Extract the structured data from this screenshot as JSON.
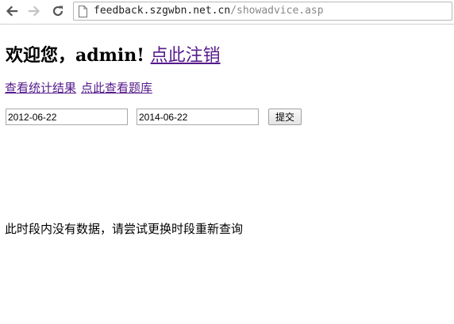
{
  "browser": {
    "url_host": "feedback.szgwbn.net.cn",
    "url_path": "/showadvice.asp"
  },
  "page": {
    "welcome_text": "欢迎您，admin! ",
    "logout_link": "点此注销",
    "stats_link": "查看统计结果",
    "question_bank_link": "点此查看题库",
    "start_date": "2012-06-22",
    "end_date": "2014-06-22",
    "submit_label": "提交",
    "no_data_message": "此时段内没有数据，请尝试更换时段重新查询"
  }
}
